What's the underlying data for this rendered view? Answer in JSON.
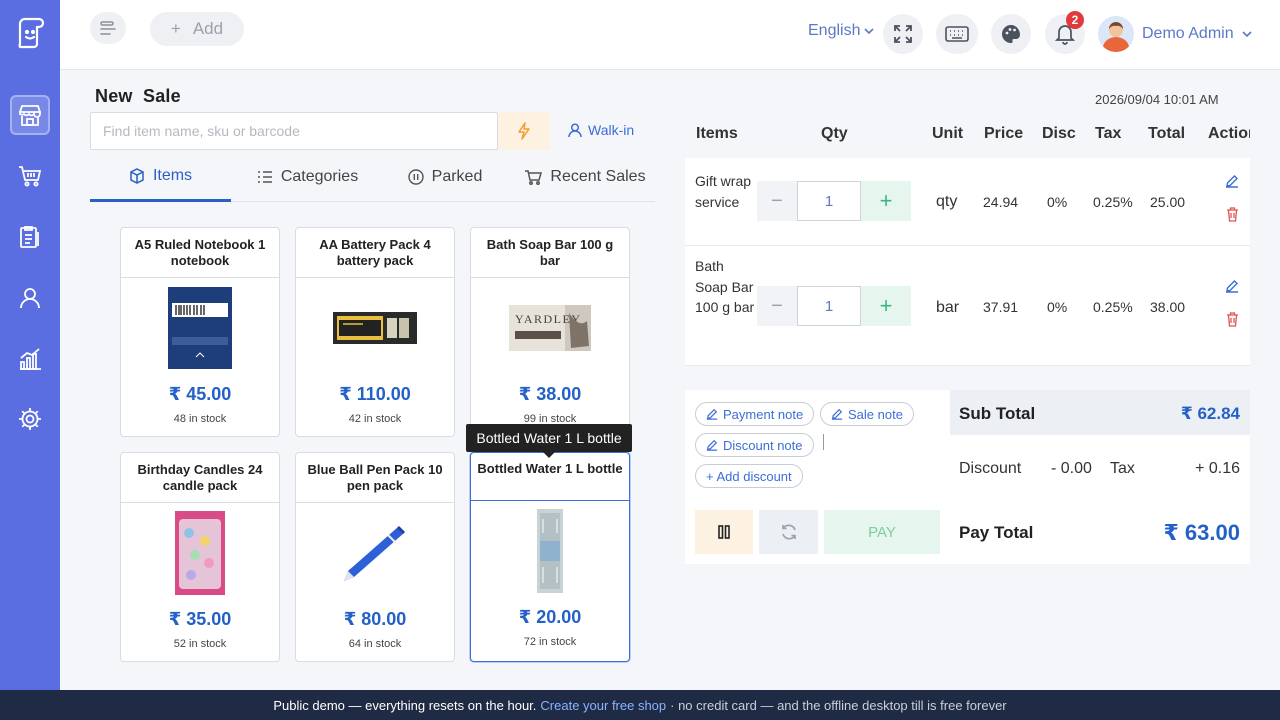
{
  "header": {
    "add_label": "Add",
    "language": "English",
    "notification_count": "2",
    "user_name": "Demo Admin"
  },
  "sale": {
    "title": "New  Sale",
    "search_placeholder": "Find item name, sku or barcode",
    "customer": "Walk-in",
    "datetime": "2026/09/04 10:01 AM"
  },
  "tabs": [
    {
      "label": "Items",
      "icon": "cube-icon"
    },
    {
      "label": "Categories",
      "icon": "list-icon"
    },
    {
      "label": "Parked",
      "icon": "pause-circle-icon"
    },
    {
      "label": "Recent Sales",
      "icon": "cart-icon"
    }
  ],
  "products": [
    {
      "name": "A5 Ruled Notebook 1 notebook",
      "price": "₹ 45.00",
      "stock": "48 in stock"
    },
    {
      "name": "AA Battery Pack 4 battery pack",
      "price": "₹ 110.00",
      "stock": "42 in stock"
    },
    {
      "name": "Bath Soap Bar 100 g bar",
      "price": "₹ 38.00",
      "stock": "99 in stock"
    },
    {
      "name": "Birthday Candles 24 candle pack",
      "price": "₹ 35.00",
      "stock": "52 in stock"
    },
    {
      "name": "Blue Ball Pen Pack 10 pen pack",
      "price": "₹ 80.00",
      "stock": "64 in stock"
    },
    {
      "name": "Bottled Water 1 L bottle",
      "price": "₹ 20.00",
      "stock": "72 in stock"
    }
  ],
  "tooltip": "Bottled Water 1 L bottle",
  "cart": {
    "headers": {
      "items": "Items",
      "qty": "Qty",
      "unit": "Unit",
      "price": "Price",
      "disc": "Disc",
      "tax": "Tax",
      "total": "Total",
      "action": "Action"
    },
    "rows": [
      {
        "name": "Gift wrap service",
        "qty": "1",
        "unit": "qty",
        "price": "24.94",
        "disc": "0%",
        "tax": "0.25%",
        "total": "25.00"
      },
      {
        "name": "Bath Soap Bar 100 g bar",
        "qty": "1",
        "unit": "bar",
        "price": "37.91",
        "disc": "0%",
        "tax": "0.25%",
        "total": "38.00"
      }
    ]
  },
  "notes": {
    "payment_note": "Payment note",
    "sale_note": "Sale note",
    "discount_note": "Discount note",
    "add_discount": "+ Add discount"
  },
  "totals": {
    "subtotal_label": "Sub Total",
    "subtotal_value": "₹ 62.84",
    "discount_label": "Discount",
    "discount_value": "- 0.00",
    "tax_label": "Tax",
    "tax_value": "+ 0.16",
    "pay_total_label": "Pay Total",
    "pay_total_value": "₹ 63.00",
    "pay_label": "PAY"
  },
  "footer": {
    "text1": "Public demo — everything resets on the hour.",
    "link": "Create your free shop",
    "text2": "· no credit card — and the offline desktop till is free forever"
  },
  "colors": {
    "sidebar": "#5b6ee1",
    "accent": "#2361c8",
    "pay_green": "#3bb77e",
    "footer": "#1f2a44"
  }
}
